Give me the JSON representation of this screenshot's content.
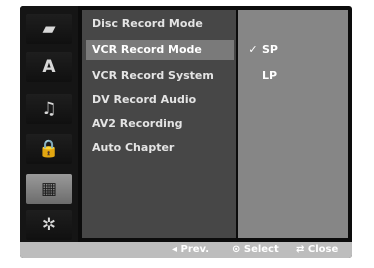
{
  "sidebar": {
    "icons": [
      {
        "name": "disc-icon",
        "glyph": "▰"
      },
      {
        "name": "language-icon",
        "glyph": "A"
      },
      {
        "name": "audio-icon",
        "glyph": "♫"
      },
      {
        "name": "lock-icon",
        "glyph": "🔒"
      },
      {
        "name": "recording-icon",
        "glyph": "▦"
      },
      {
        "name": "others-icon",
        "glyph": "✲"
      }
    ],
    "active_index": 4
  },
  "menu": {
    "items": [
      {
        "label": "Disc Record Mode"
      },
      {
        "label": "VCR Record Mode"
      },
      {
        "label": "VCR Record System"
      },
      {
        "label": "DV Record Audio"
      },
      {
        "label": "AV2 Recording"
      },
      {
        "label": "Auto Chapter"
      }
    ],
    "selected_index": 1
  },
  "options": {
    "items": [
      {
        "check": "✓",
        "label": "SP"
      },
      {
        "check": "",
        "label": "LP"
      }
    ]
  },
  "footer": {
    "prev": "◂ Prev.",
    "select": "⊙ Select",
    "close": "⇄ Close"
  }
}
